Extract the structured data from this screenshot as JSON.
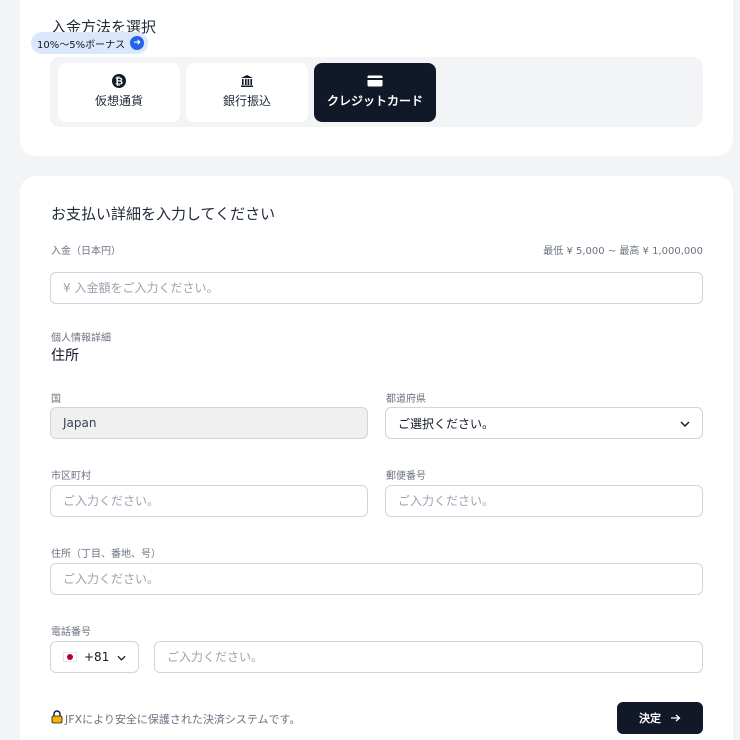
{
  "method_section": {
    "title": "入金方法を選択",
    "bonus_badge": "10%〜5%ボーナス",
    "methods": [
      {
        "label": "仮想通貨",
        "icon": "bitcoin-icon"
      },
      {
        "label": "銀行振込",
        "icon": "bank-icon"
      },
      {
        "label": "クレジットカード",
        "icon": "credit-card-icon",
        "selected": true
      }
    ]
  },
  "details_section": {
    "title": "お支払い詳細を入力してください",
    "amount": {
      "label": "入金（日本円）",
      "limits": "最低 ¥ 5,000 ~ 最高 ¥ 1,000,000",
      "placeholder": "¥ 入金額をご入力ください。"
    },
    "personal_label": "個人情報詳細",
    "address_heading": "住所",
    "country": {
      "label": "国",
      "value": "Japan"
    },
    "prefecture": {
      "label": "都道府県",
      "value": "ご選択ください。"
    },
    "city": {
      "label": "市区町村",
      "placeholder": "ご入力ください。"
    },
    "postal": {
      "label": "郵便番号",
      "placeholder": "ご入力ください。"
    },
    "street": {
      "label": "住所（丁目、番地、号）",
      "placeholder": "ご入力ください。"
    },
    "phone": {
      "label": "電話番号",
      "country_code": "+81",
      "placeholder": "ご入力ください。"
    },
    "security_note": "JFXにより安全に保護された決済システムです。",
    "submit_label": "決定"
  },
  "colors": {
    "primary_dark": "#111827",
    "badge_bg": "#dbe7fb",
    "accent_blue": "#2563eb",
    "page_bg": "#f3f4f6"
  }
}
